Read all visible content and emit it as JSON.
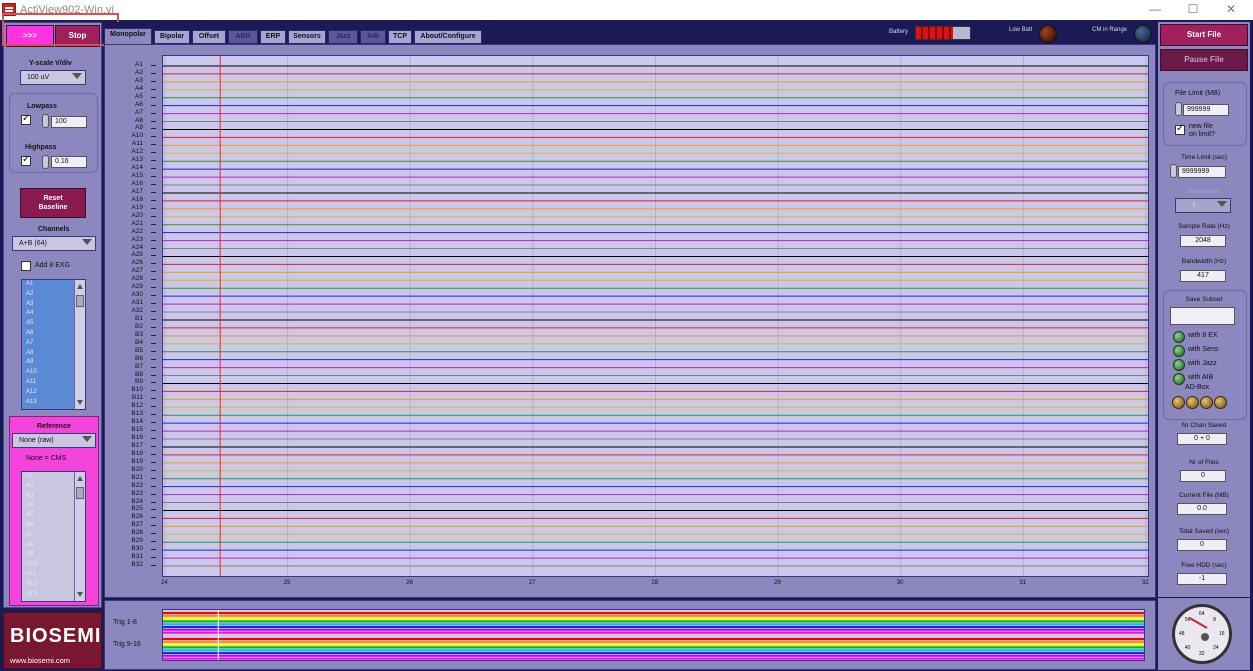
{
  "window": {
    "title": "ActiView902-Win.vi",
    "controls": {
      "minimize": "—",
      "maximize": "☐",
      "close": "✕"
    }
  },
  "left": {
    "run_label": ">>>",
    "stop_label": "Stop",
    "yscale_label": "Y-scale V/div",
    "yscale_value": "100 uV",
    "lowpass_label": "Lowpass",
    "lowpass_value": "100",
    "lowpass_checked": true,
    "highpass_label": "Highpass",
    "highpass_value": "0.16",
    "highpass_checked": true,
    "reset_label_1": "Reset",
    "reset_label_2": "Baseline",
    "channels_label": "Channels",
    "channels_value": "A+B (64)",
    "add_exg_label": "Add 8 EXG",
    "channel_list": [
      "A1",
      "A2",
      "A3",
      "A4",
      "A5",
      "A6",
      "A7",
      "A8",
      "A9",
      "A10",
      "A11",
      "A12",
      "A13"
    ],
    "reference_label": "Reference",
    "reference_value": "None (raw)",
    "reference_note": "None = CMS",
    "reference_list": [
      "A1",
      "A2",
      "A3",
      "A4",
      "A5",
      "A6",
      "A7",
      "A8",
      "A9",
      "A10",
      "A11",
      "A12",
      "A13"
    ]
  },
  "tabs": [
    {
      "label": "Monopolar",
      "state": "active"
    },
    {
      "label": "Bipolar",
      "state": "normal"
    },
    {
      "label": "Offset",
      "state": "normal"
    },
    {
      "label": "ABR",
      "state": "dim"
    },
    {
      "label": "ERP",
      "state": "normal"
    },
    {
      "label": "Sensors",
      "state": "normal"
    },
    {
      "label": "Jazz",
      "state": "dim"
    },
    {
      "label": "AIB",
      "state": "dim"
    },
    {
      "label": "TCP",
      "state": "normal"
    },
    {
      "label": "About/Configure",
      "state": "normal"
    }
  ],
  "status": {
    "battery_label": "Battery",
    "lowbatt_label": "Low Batt",
    "cm_label": "CM in Range"
  },
  "plot": {
    "channels": [
      "A1",
      "A2",
      "A3",
      "A4",
      "A5",
      "A6",
      "A7",
      "A8",
      "A9",
      "A10",
      "A11",
      "A12",
      "A13",
      "A14",
      "A15",
      "A16",
      "A17",
      "A18",
      "A19",
      "A20",
      "A21",
      "A22",
      "A23",
      "A24",
      "A25",
      "A26",
      "A27",
      "A28",
      "A29",
      "A30",
      "A31",
      "A32",
      "B1",
      "B2",
      "B3",
      "B4",
      "B5",
      "B6",
      "B7",
      "B8",
      "B9",
      "B10",
      "B11",
      "B12",
      "B13",
      "B14",
      "B15",
      "B16",
      "B17",
      "B18",
      "B19",
      "B20",
      "B21",
      "B22",
      "B23",
      "B24",
      "B25",
      "B26",
      "B27",
      "B28",
      "B29",
      "B30",
      "B31",
      "B32"
    ],
    "trace_colors": [
      "#000000",
      "#e02020",
      "#f0a000",
      "#c8c800",
      "#20a020",
      "#2020e0",
      "#c020c0",
      "#808080"
    ],
    "x_ticks": [
      "24",
      "25",
      "26",
      "27",
      "28",
      "29",
      "30",
      "31",
      "32"
    ],
    "cursor_x": 24.45,
    "trig_labels": [
      "Trig 1-8",
      "Trig 9-16"
    ],
    "trig_colors": [
      "#ff0000",
      "#ff8c00",
      "#ffff00",
      "#00c000",
      "#00c0ff",
      "#2020ff",
      "#c000ff",
      "#ff00ff"
    ]
  },
  "right": {
    "start_label": "Start File",
    "pause_label": "Pause File",
    "file_limit_label": "File Limit (MB)",
    "file_limit_value": "999999",
    "newfile_label_1": "new file",
    "newfile_label_2": "on limit?",
    "newfile_checked": true,
    "time_limit_label": "Time Limit (sec)",
    "time_limit_value": "9999999",
    "decimation_label": "Decimation",
    "decimation_value": "1",
    "sample_rate_label": "Sample Rate (Hz)",
    "sample_rate_value": "2048",
    "bandwidth_label": "Bandwidth (Hz)",
    "bandwidth_value": "417",
    "save_subset_label": "Save Subset",
    "with_8ex": "with 8 EX",
    "with_sens": "with Sens",
    "with_jazz": "with Jazz",
    "with_aib": "with AIB",
    "adbox_label": "AD-Box",
    "nr_chan_label": "Nr Chan Saved",
    "nr_chan_value": "0 + 0",
    "nr_files_label": "Nr of Files",
    "nr_files_value": "0",
    "current_file_label": "Current File (MB)",
    "current_file_value": "0.0",
    "total_saved_label": "Total Saved (sec)",
    "total_saved_value": "0",
    "free_hdd_label": "Free HDD (sec)",
    "free_hdd_value": "-1"
  },
  "gauge": {
    "ticks": [
      "64",
      "8",
      "16",
      "24",
      "32",
      "40",
      "48",
      "56"
    ]
  },
  "logo": {
    "brand": "BIOSEMI",
    "url": "www.biosemi.com"
  }
}
